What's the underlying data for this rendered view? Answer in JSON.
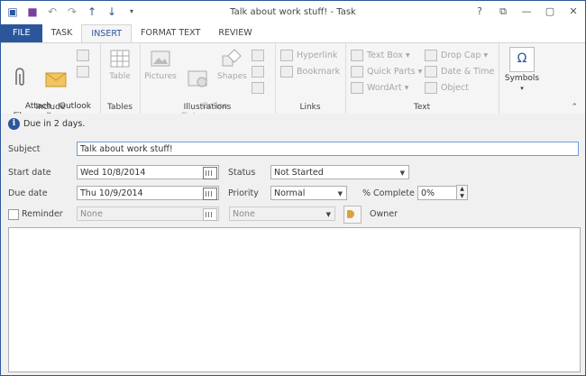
{
  "window": {
    "title": "Talk about work stuff! - Task"
  },
  "quick_access": [
    "task-icon",
    "save-icon",
    "undo-icon",
    "redo-icon",
    "up-arrow-icon",
    "down-arrow-icon",
    "customize-icon"
  ],
  "window_buttons": [
    "?",
    "⧉",
    "—",
    "▢",
    "✕"
  ],
  "tabs": [
    {
      "label": "FILE"
    },
    {
      "label": "TASK"
    },
    {
      "label": "INSERT"
    },
    {
      "label": "FORMAT TEXT"
    },
    {
      "label": "REVIEW"
    }
  ],
  "ribbon": {
    "include": {
      "label": "Include",
      "attach_file": "Attach\nFile",
      "outlook_item": "Outlook\nItem"
    },
    "tables": {
      "label": "Tables",
      "table": "Table"
    },
    "illustrations": {
      "label": "Illustrations",
      "pictures": "Pictures",
      "online_pictures": "Online\nPictures",
      "shapes": "Shapes"
    },
    "links": {
      "label": "Links",
      "hyperlink": "Hyperlink",
      "bookmark": "Bookmark"
    },
    "text": {
      "label": "Text",
      "text_box": "Text Box",
      "quick_parts": "Quick Parts",
      "wordart": "WordArt",
      "drop_cap": "Drop Cap",
      "date_time": "Date & Time",
      "object": "Object"
    },
    "symbols": {
      "label": "Symbols",
      "omega": "Ω"
    }
  },
  "info": {
    "text": "Due in 2 days."
  },
  "form": {
    "subject_label": "Subject",
    "subject_value": "Talk about work stuff!",
    "start_date_label": "Start date",
    "start_date_value": "Wed 10/8/2014",
    "due_date_label": "Due date",
    "due_date_value": "Thu 10/9/2014",
    "status_label": "Status",
    "status_value": "Not Started",
    "priority_label": "Priority",
    "priority_value": "Normal",
    "percent_label": "% Complete",
    "percent_value": "0%",
    "reminder_label": "Reminder",
    "reminder_date": "None",
    "reminder_time": "None",
    "owner_label": "Owner"
  }
}
